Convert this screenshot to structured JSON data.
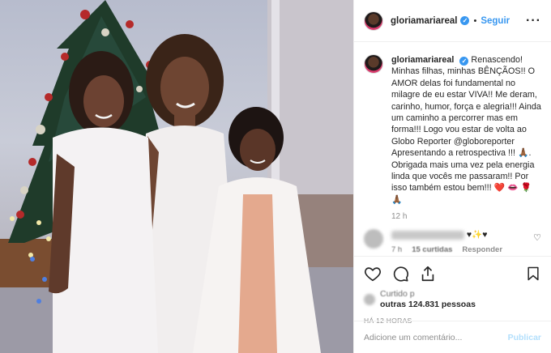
{
  "post": {
    "username": "gloriamariareal",
    "verified_mark": "✓",
    "separator": "•",
    "follow_label": "Seguir",
    "more_glyph": "···"
  },
  "caption": {
    "username": "gloriamariareal",
    "text": "Renascendo! Minhas filhas, minhas BÊNÇÃOS!! O AMOR delas foi fundamental no milagre de eu estar VIVA!! Me deram, carinho, humor, força e alegria!!! Ainda um caminho a percorrer mas em forma!!! Logo vou estar de volta ao Globo Reporter @globoreporter Apresentando a retrospectiva !!! 🙏🏾. Obrigada mais uma vez pela energia linda que vocês me passaram!! Por isso também estou bem!!! ❤️ 👄 🌹 🙏🏾",
    "time": "12 h"
  },
  "reply": {
    "text": "♥✨♥",
    "meta_time": "7 h",
    "meta_likes": "15 curtidas",
    "meta_reply": "Responder",
    "heart_glyph": "♡"
  },
  "likes": {
    "line1": "Curtido p",
    "line2": "outras 124.831 pessoas"
  },
  "timestamp": "HÁ 12 HORAS",
  "comment_input": {
    "placeholder": "Adicione um comentário...",
    "publish_label": "Publicar"
  },
  "colors": {
    "accent": "#3897f0",
    "publish_disabled": "#b2dffc",
    "muted": "#8e8e8e"
  },
  "icons": [
    "heart-icon",
    "comment-icon",
    "share-icon",
    "bookmark-icon",
    "more-options-icon",
    "verified-badge-icon"
  ]
}
